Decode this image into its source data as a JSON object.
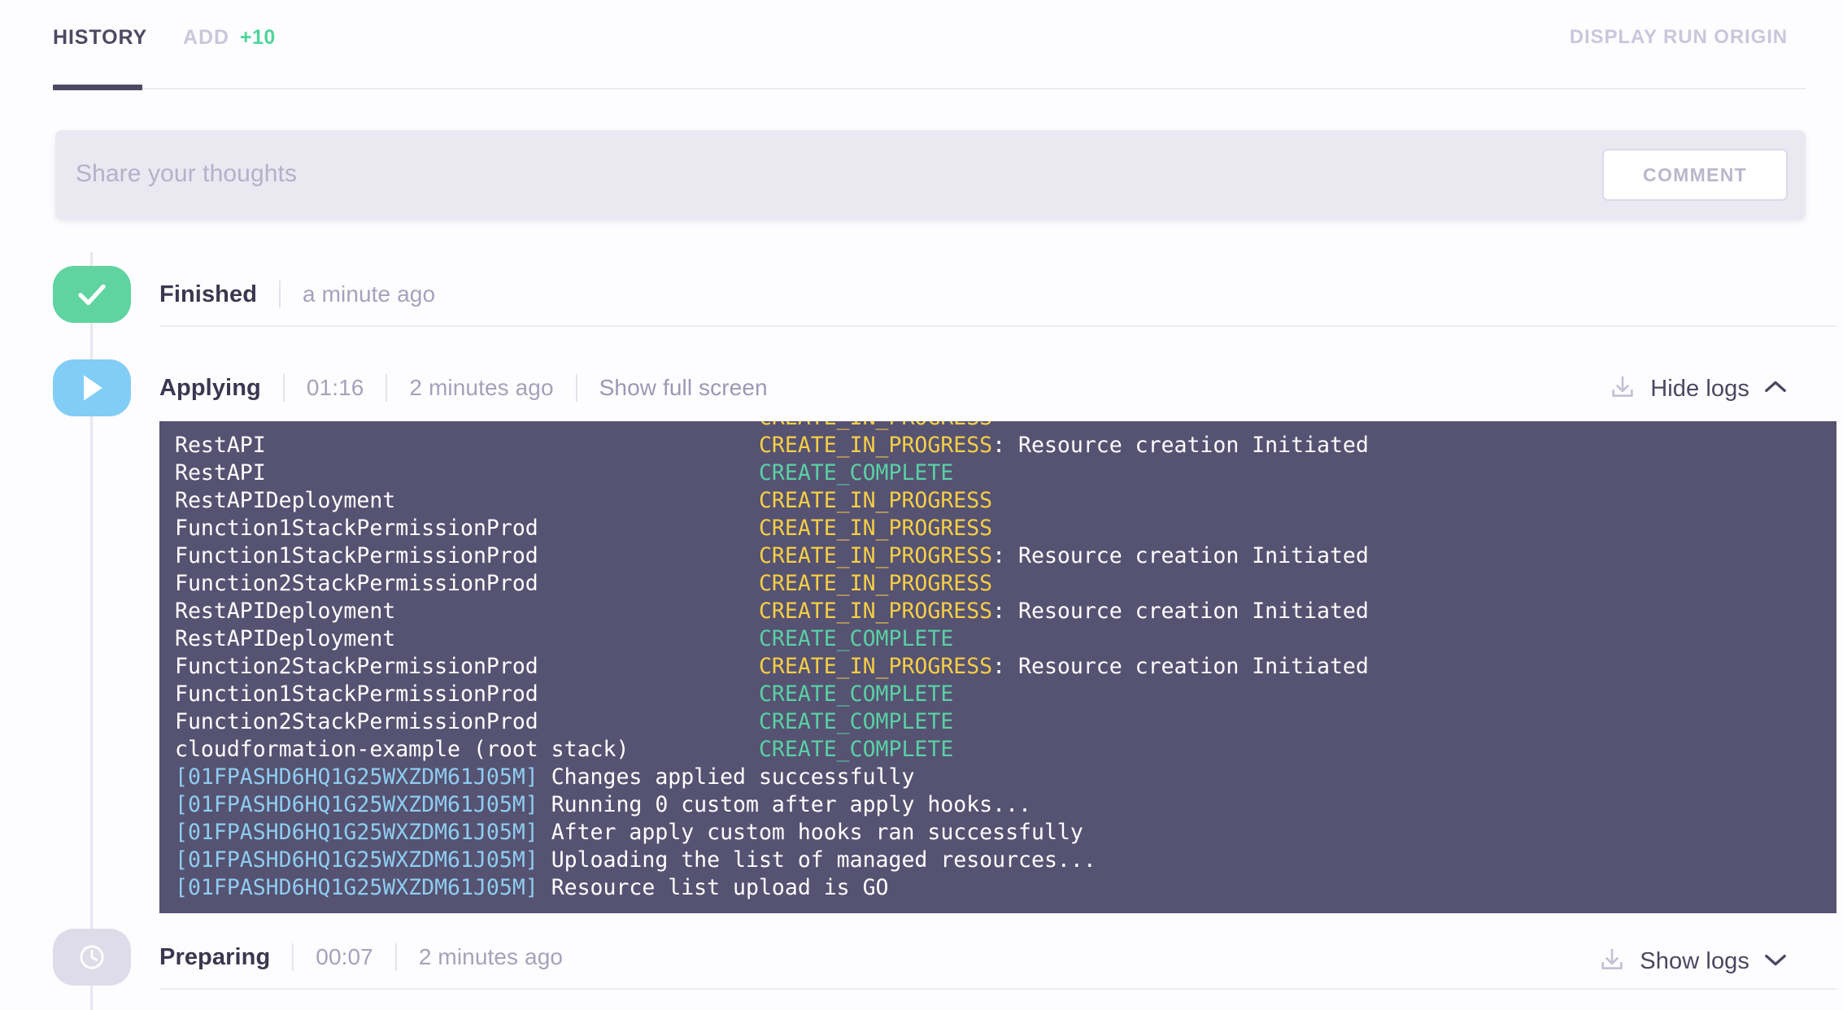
{
  "header": {
    "tabs": [
      {
        "label": "HISTORY",
        "active": true
      },
      {
        "label": "ADD",
        "active": false,
        "badge": "+10"
      }
    ],
    "display_run_origin": "DISPLAY RUN ORIGIN"
  },
  "comment": {
    "placeholder": "Share your thoughts",
    "value": "",
    "button_label": "COMMENT"
  },
  "timeline": {
    "finished": {
      "name": "Finished",
      "time_ago": "a minute ago",
      "icon": "check-icon",
      "icon_color": "#5fd3a0"
    },
    "applying": {
      "name": "Applying",
      "duration": "01:16",
      "time_ago": "2 minutes ago",
      "fullscreen_label": "Show full screen",
      "logs_toggle_label": "Hide logs",
      "icon": "play-icon",
      "icon_color": "#82cdf5",
      "chevron": "chevron-up-icon"
    },
    "preparing": {
      "name": "Preparing",
      "duration": "00:07",
      "time_ago": "2 minutes ago",
      "logs_toggle_label": "Show logs",
      "icon": "clock-icon",
      "icon_color": "#dfdce9",
      "chevron": "chevron-down-icon"
    }
  },
  "log_colors": {
    "background": "#565272",
    "in_progress": "#f5cf44",
    "complete": "#59d1a4",
    "run_id": "#8ecdf0",
    "text": "#ffffff"
  },
  "log_lines": [
    {
      "clipped": true,
      "resource": "",
      "status": "CREATE_IN_PROGRESS",
      "status_type": "in_progress",
      "detail": ""
    },
    {
      "resource": "RestAPI",
      "status": "CREATE_IN_PROGRESS",
      "status_type": "in_progress",
      "detail": ": Resource creation Initiated"
    },
    {
      "resource": "RestAPI",
      "status": "CREATE_COMPLETE",
      "status_type": "complete",
      "detail": ""
    },
    {
      "resource": "RestAPIDeployment",
      "status": "CREATE_IN_PROGRESS",
      "status_type": "in_progress",
      "detail": ""
    },
    {
      "resource": "Function1StackPermissionProd",
      "status": "CREATE_IN_PROGRESS",
      "status_type": "in_progress",
      "detail": ""
    },
    {
      "resource": "Function1StackPermissionProd",
      "status": "CREATE_IN_PROGRESS",
      "status_type": "in_progress",
      "detail": ": Resource creation Initiated"
    },
    {
      "resource": "Function2StackPermissionProd",
      "status": "CREATE_IN_PROGRESS",
      "status_type": "in_progress",
      "detail": ""
    },
    {
      "resource": "RestAPIDeployment",
      "status": "CREATE_IN_PROGRESS",
      "status_type": "in_progress",
      "detail": ": Resource creation Initiated"
    },
    {
      "resource": "RestAPIDeployment",
      "status": "CREATE_COMPLETE",
      "status_type": "complete",
      "detail": ""
    },
    {
      "resource": "Function2StackPermissionProd",
      "status": "CREATE_IN_PROGRESS",
      "status_type": "in_progress",
      "detail": ": Resource creation Initiated"
    },
    {
      "resource": "Function1StackPermissionProd",
      "status": "CREATE_COMPLETE",
      "status_type": "complete",
      "detail": ""
    },
    {
      "resource": "Function2StackPermissionProd",
      "status": "CREATE_COMPLETE",
      "status_type": "complete",
      "detail": ""
    },
    {
      "resource": "cloudformation-example (root stack)",
      "status": "CREATE_COMPLETE",
      "status_type": "complete",
      "detail": ""
    },
    {
      "run_id": "[01FPASHD6HQ1G25WXZDM61J05M]",
      "message": "Changes applied successfully"
    },
    {
      "run_id": "[01FPASHD6HQ1G25WXZDM61J05M]",
      "message": "Running 0 custom after apply hooks..."
    },
    {
      "run_id": "[01FPASHD6HQ1G25WXZDM61J05M]",
      "message": "After apply custom hooks ran successfully"
    },
    {
      "run_id": "[01FPASHD6HQ1G25WXZDM61J05M]",
      "message": "Uploading the list of managed resources..."
    },
    {
      "run_id": "[01FPASHD6HQ1G25WXZDM61J05M]",
      "message": "Resource list upload is GO"
    }
  ]
}
